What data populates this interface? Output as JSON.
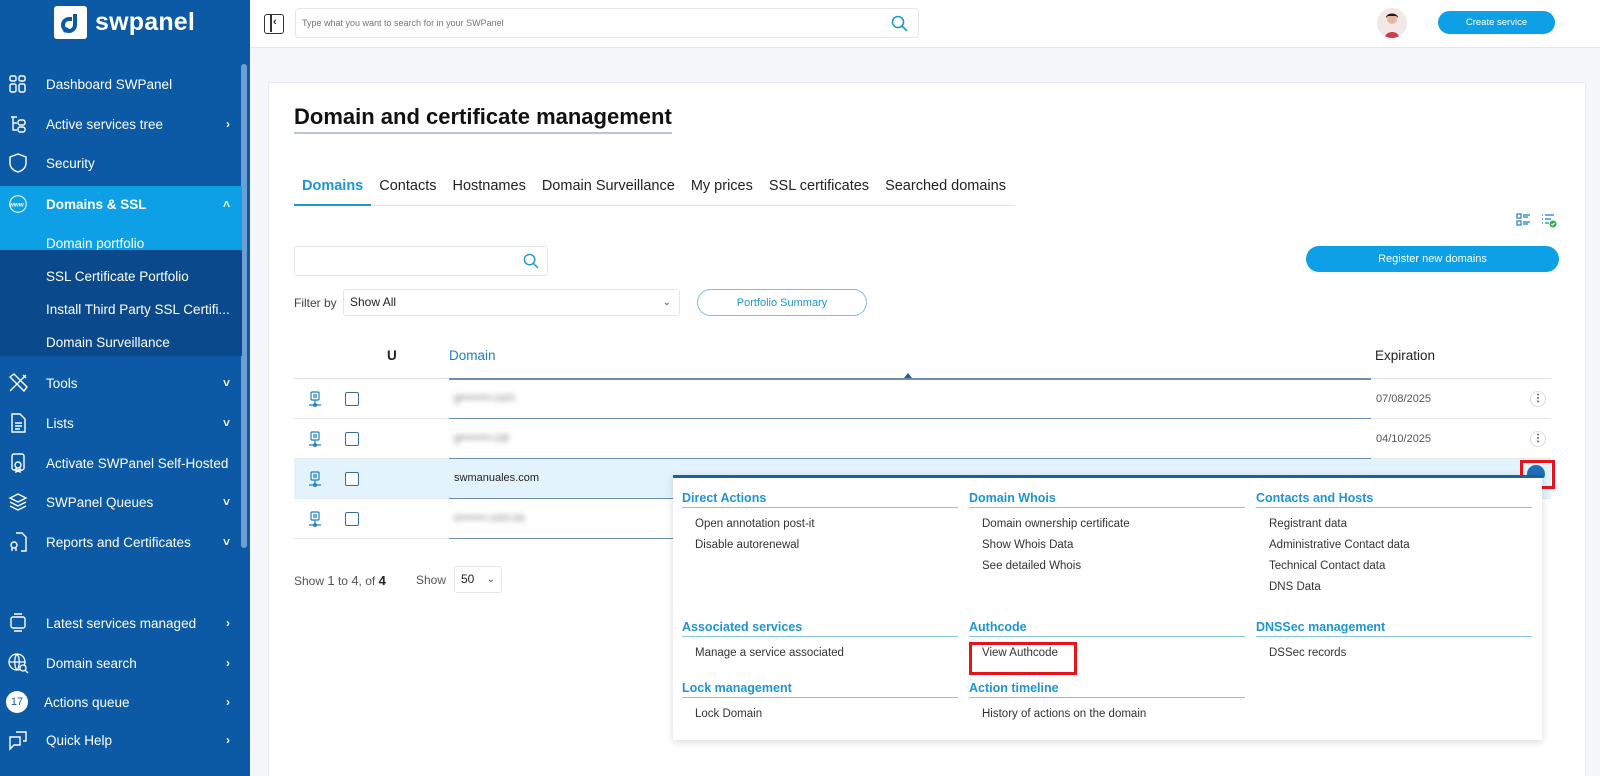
{
  "brand": {
    "name": "swpanel"
  },
  "sidebar": {
    "items": [
      {
        "label": "Dashboard SWPanel",
        "icon": "dashboard-icon"
      },
      {
        "label": "Active services tree",
        "icon": "tree-icon",
        "chevron": "›"
      },
      {
        "label": "Security",
        "icon": "shield-icon"
      },
      {
        "label": "Domains & SSL",
        "icon": "www-icon",
        "chevron": "˄"
      },
      {
        "label": "Tools",
        "icon": "tools-icon",
        "chevron": "˅"
      },
      {
        "label": "Lists",
        "icon": "document-icon",
        "chevron": "˅"
      },
      {
        "label": "Activate SWPanel Self-Hosted",
        "icon": "certificate-icon"
      },
      {
        "label": "SWPanel Queues",
        "icon": "layers-icon",
        "chevron": "˅"
      },
      {
        "label": "Reports and Certificates",
        "icon": "report-icon",
        "chevron": "˅"
      },
      {
        "label": "Latest services managed",
        "icon": "monitor-icon",
        "chevron": "›"
      },
      {
        "label": "Domain search",
        "icon": "globe-search-icon",
        "chevron": "›"
      },
      {
        "label": "Actions queue",
        "badge": "17",
        "chevron": "›"
      },
      {
        "label": "Quick Help",
        "icon": "chat-icon",
        "chevron": "›"
      }
    ],
    "subitems": [
      "Domain portfolio",
      "SSL Certificate Portfolio",
      "Install Third Party SSL Certifi...",
      "Domain Surveillance"
    ]
  },
  "topbar": {
    "search_placeholder": "Type what you want to search for in your SWPanel",
    "create_label": "Create service"
  },
  "main": {
    "title": "Domain and certificate management",
    "tabs": [
      "Domains",
      "Contacts",
      "Hostnames",
      "Domain Surveillance",
      "My prices",
      "SSL certificates",
      "Searched domains"
    ],
    "active_tab": "Domains",
    "register_label": "Register new domains",
    "filter_label": "Filter by",
    "filter_value": "Show All",
    "portfolio_label": "Portfolio Summary",
    "table": {
      "headers": {
        "u": "U",
        "domain": "Domain",
        "expiration": "Expiration"
      },
      "rows": [
        {
          "domain": "g••••••••.com",
          "expiration": "07/08/2025",
          "blurred": true
        },
        {
          "domain": "g••••••••.cat",
          "expiration": "04/10/2025",
          "blurred": true
        },
        {
          "domain": "swmanuales.com",
          "expiration": "",
          "blurred": false,
          "selected": true
        },
        {
          "domain": "s•••••••.com.es",
          "expiration": "",
          "blurred": true
        }
      ]
    },
    "pagination": {
      "prefix": "Show",
      "from": "1",
      "to_text": "to",
      "to": "4",
      "of_text": ", of",
      "total": "4",
      "show_label": "Show",
      "page_size": "50"
    }
  },
  "menu": {
    "groups": [
      {
        "title": "Direct Actions",
        "items": [
          "Open annotation post-it",
          "Disable autorenewal"
        ]
      },
      {
        "title": "Domain Whois",
        "items": [
          "Domain ownership certificate",
          "Show Whois Data",
          "See detailed Whois"
        ]
      },
      {
        "title": "Contacts and Hosts",
        "items": [
          "Registrant data",
          "Administrative Contact data",
          "Technical Contact data",
          "DNS Data"
        ]
      },
      {
        "title": "Associated services",
        "items": [
          "Manage a service associated"
        ]
      },
      {
        "title": "Authcode",
        "items": [
          "View Authcode"
        ]
      },
      {
        "title": "DNSSec management",
        "items": [
          "DSSec records"
        ]
      },
      {
        "title": "Lock management",
        "items": [
          "Lock Domain"
        ]
      },
      {
        "title": "Action timeline",
        "items": [
          "History of actions on the domain"
        ]
      }
    ],
    "highlighted_item": "View Authcode"
  },
  "colors": {
    "sidebar": "#0c5aa6",
    "accent": "#0ea0e6",
    "highlight": "#e5141b"
  }
}
